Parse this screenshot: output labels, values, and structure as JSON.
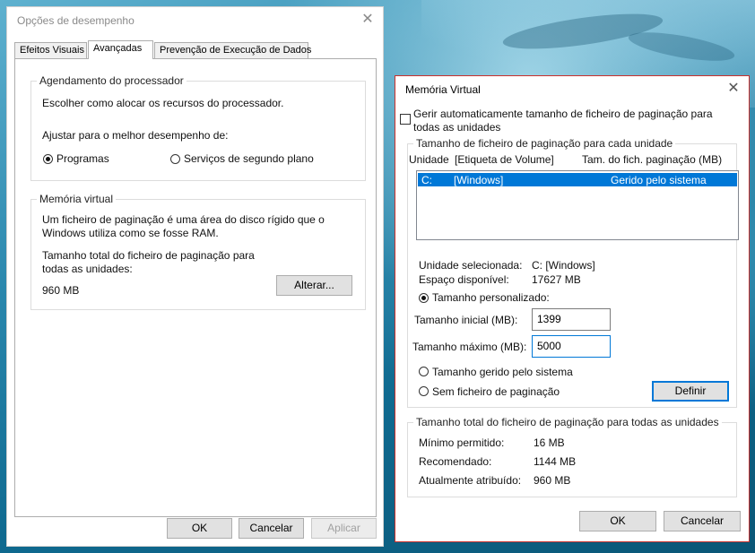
{
  "perf": {
    "title": "Opções de desempenho",
    "tabs": [
      "Efeitos Visuais",
      "Avançadas",
      "Prevenção de Execução de Dados"
    ],
    "processor": {
      "group_label": "Agendamento do processador",
      "description": "Escolher como alocar os recursos do processador.",
      "adjust_label": "Ajustar para o melhor desempenho de:",
      "option_programs": "Programas",
      "option_services": "Serviços de segundo plano"
    },
    "virtual": {
      "group_label": "Memória virtual",
      "description_line1": "Um ficheiro de paginação é uma área do disco rígido que o",
      "description_line2": "Windows utiliza como se fosse RAM.",
      "total_label_line1": "Tamanho total do ficheiro de paginação para",
      "total_label_line2": "todas as unidades:",
      "total_value": "960 MB",
      "change_button": "Alterar..."
    },
    "buttons": {
      "ok": "OK",
      "cancel": "Cancelar",
      "apply": "Aplicar"
    }
  },
  "vm": {
    "title": "Memória Virtual",
    "auto_manage_line1": "Gerir automaticamente tamanho de ficheiro de paginação para",
    "auto_manage_line2": "todas as unidades",
    "auto_manage_checked": false,
    "per_drive_label": "Tamanho de ficheiro de paginação para cada unidade",
    "columns": [
      "Unidade",
      "[Etiqueta de Volume]",
      "Tam. do fich. paginação (MB)"
    ],
    "drives": [
      {
        "drive": "C:",
        "label": "[Windows]",
        "size": "Gerido pelo sistema",
        "selected": true
      }
    ],
    "selected_drive_label": "Unidade selecionada:",
    "selected_drive_value": "C:  [Windows]",
    "free_space_label": "Espaço disponível:",
    "free_space_value": "17627 MB",
    "custom_size_label": "Tamanho personalizado:",
    "initial_size_label": "Tamanho inicial (MB):",
    "initial_size_value": "1399",
    "max_size_label": "Tamanho máximo (MB):",
    "max_size_value": "5000",
    "system_managed_label": "Tamanho gerido pelo sistema",
    "no_paging_label": "Sem ficheiro de paginação",
    "set_button": "Definir",
    "totals_label": "Tamanho total do ficheiro de paginação para todas as unidades",
    "min_label": "Mínimo permitido:",
    "min_value": "16 MB",
    "recommended_label": "Recomendado:",
    "recommended_value": "1144 MB",
    "current_label": "Atualmente atribuído:",
    "current_value": "960 MB",
    "buttons": {
      "ok": "OK",
      "cancel": "Cancelar"
    }
  },
  "colors": {
    "selection": "#0078d7",
    "active_border": "#c9302c"
  }
}
